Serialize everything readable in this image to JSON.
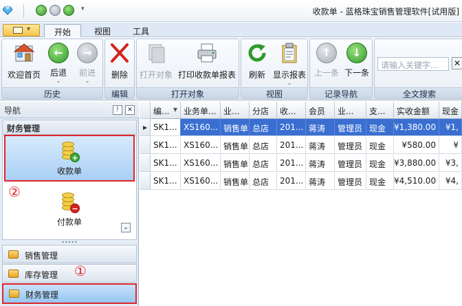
{
  "window": {
    "title": "收款单 - 蓝格珠宝销售管理软件[试用版]"
  },
  "tabs": [
    {
      "label": "开始",
      "active": true
    },
    {
      "label": "视图",
      "active": false
    },
    {
      "label": "工具",
      "active": false
    }
  ],
  "ribbon": {
    "groups": {
      "history": "历史",
      "edit": "编辑",
      "open_object": "打开对象",
      "view": "视图",
      "record_nav": "记录导航",
      "fulltext": "全文搜索"
    },
    "buttons": {
      "welcome": "欢迎首页",
      "back": "后退",
      "forward": "前进",
      "delete": "删除",
      "open": "打开对象",
      "print": "打印收款单报表",
      "refresh": "刷新",
      "show_report": "显示报表",
      "prev": "上一条",
      "next": "下一条"
    },
    "search": {
      "placeholder": "请输入关键字...",
      "clear": "✕"
    }
  },
  "nav": {
    "header": "导航",
    "pin": "ᚹ",
    "close": "✕",
    "group_title": "财务管理",
    "items": [
      {
        "label": "收款单",
        "selected": true,
        "badge": "+"
      },
      {
        "label": "付款单",
        "selected": false,
        "badge": "−"
      }
    ],
    "expander": "⌄",
    "modules": [
      {
        "label": "销售管理",
        "selected": false
      },
      {
        "label": "库存管理",
        "selected": false
      },
      {
        "label": "财务管理",
        "selected": true
      }
    ],
    "markers": {
      "one": "①",
      "two": "②"
    }
  },
  "grid": {
    "columns": [
      "编...",
      "业务单...",
      "业...",
      "分店",
      "收...",
      "会员",
      "业...",
      "支...",
      "实收金额",
      "现金"
    ],
    "rows": [
      [
        "SK1...",
        "XS160...",
        "销售单",
        "总店",
        "201...",
        "蒋涛",
        "管理员",
        "现金",
        "¥1,380.00",
        "¥1,"
      ],
      [
        "SK1...",
        "XS160...",
        "销售单",
        "总店",
        "201...",
        "蒋涛",
        "管理员",
        "现金",
        "¥580.00",
        "¥"
      ],
      [
        "SK1...",
        "XS160...",
        "销售单",
        "总店",
        "201...",
        "蒋涛",
        "管理员",
        "现金",
        "¥3,880.00",
        "¥3,"
      ],
      [
        "SK1...",
        "XS160...",
        "销售单",
        "总店",
        "201...",
        "蒋涛",
        "管理员",
        "现金",
        "¥4,510.00",
        "¥4,"
      ]
    ],
    "selected_row": 0
  },
  "colors": {
    "accent_red": "#e0242a",
    "selection_blue": "#3a6fd1",
    "ribbon_blue": "#dfe9f5"
  }
}
